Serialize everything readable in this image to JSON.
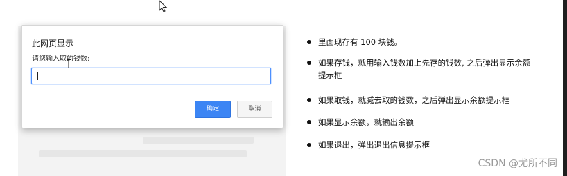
{
  "dialog": {
    "title": "此网页显示",
    "message": "请您输入取的钱数:",
    "input_value": "",
    "ok_label": "确定",
    "cancel_label": "取消"
  },
  "notes": [
    "里面现存有 100 块钱。",
    "如果存钱，就用输入钱数加上先存的钱数, 之后弹出显示余额提示框",
    "如果取钱，就减去取的钱数，之后弹出显示余额提示框",
    "如果显示余额，就输出余额",
    "如果退出，弹出退出信息提示框"
  ],
  "watermark": "CSDN @尤所不同",
  "colors": {
    "accent": "#3c85f4",
    "input_focus": "#4d90fe"
  },
  "icons": {
    "mouse_pointer": "arrow-cursor-icon",
    "text_cursor": "i-beam-cursor-icon",
    "bullet": "bullet-dot"
  }
}
